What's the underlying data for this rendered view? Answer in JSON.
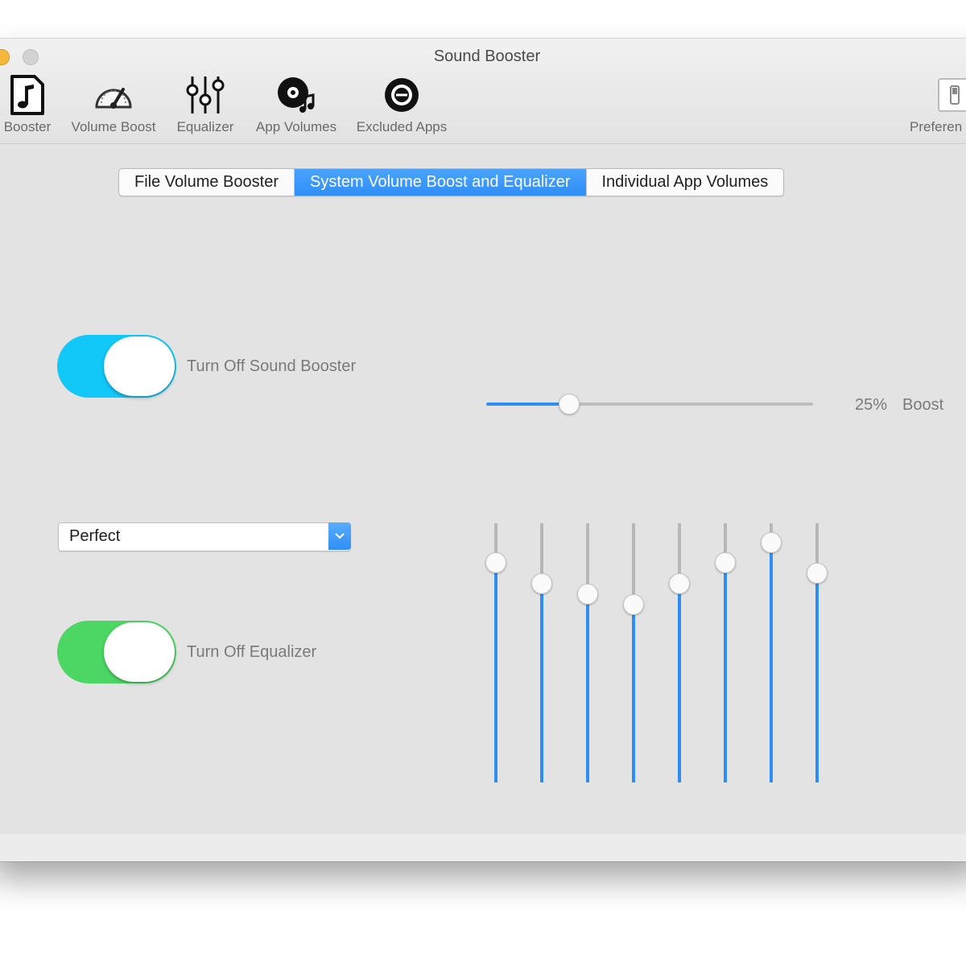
{
  "window": {
    "title": "Sound Booster"
  },
  "toolbar": {
    "items": [
      {
        "label": "Booster",
        "icon": "music-file-icon"
      },
      {
        "label": "Volume Boost",
        "icon": "speedometer-icon"
      },
      {
        "label": "Equalizer",
        "icon": "equalizer-sliders-icon"
      },
      {
        "label": "App Volumes",
        "icon": "app-volumes-icon"
      },
      {
        "label": "Excluded Apps",
        "icon": "excluded-apps-icon"
      }
    ],
    "preferences": {
      "label": "Preferen",
      "icon": "preferences-switch-icon"
    }
  },
  "tabs": [
    {
      "label": "File Volume Booster",
      "active": false
    },
    {
      "label": "System Volume Boost and Equalizer",
      "active": true
    },
    {
      "label": "Individual App Volumes",
      "active": false
    }
  ],
  "booster": {
    "toggle_label": "Turn Off Sound Booster",
    "toggle_on": true,
    "toggle_color": "#12c8f8",
    "boost_percent_text": "25%",
    "boost_word": "Boost",
    "boost_fraction": 0.25
  },
  "equalizer": {
    "preset": "Perfect",
    "toggle_label": "Turn Off Equalizer",
    "toggle_on": true,
    "toggle_color": "#4cd764",
    "bands": [
      0.85,
      0.77,
      0.73,
      0.69,
      0.77,
      0.85,
      0.93,
      0.81
    ]
  },
  "colors": {
    "accent": "#2f8ef6",
    "background": "#e3e3e3"
  }
}
